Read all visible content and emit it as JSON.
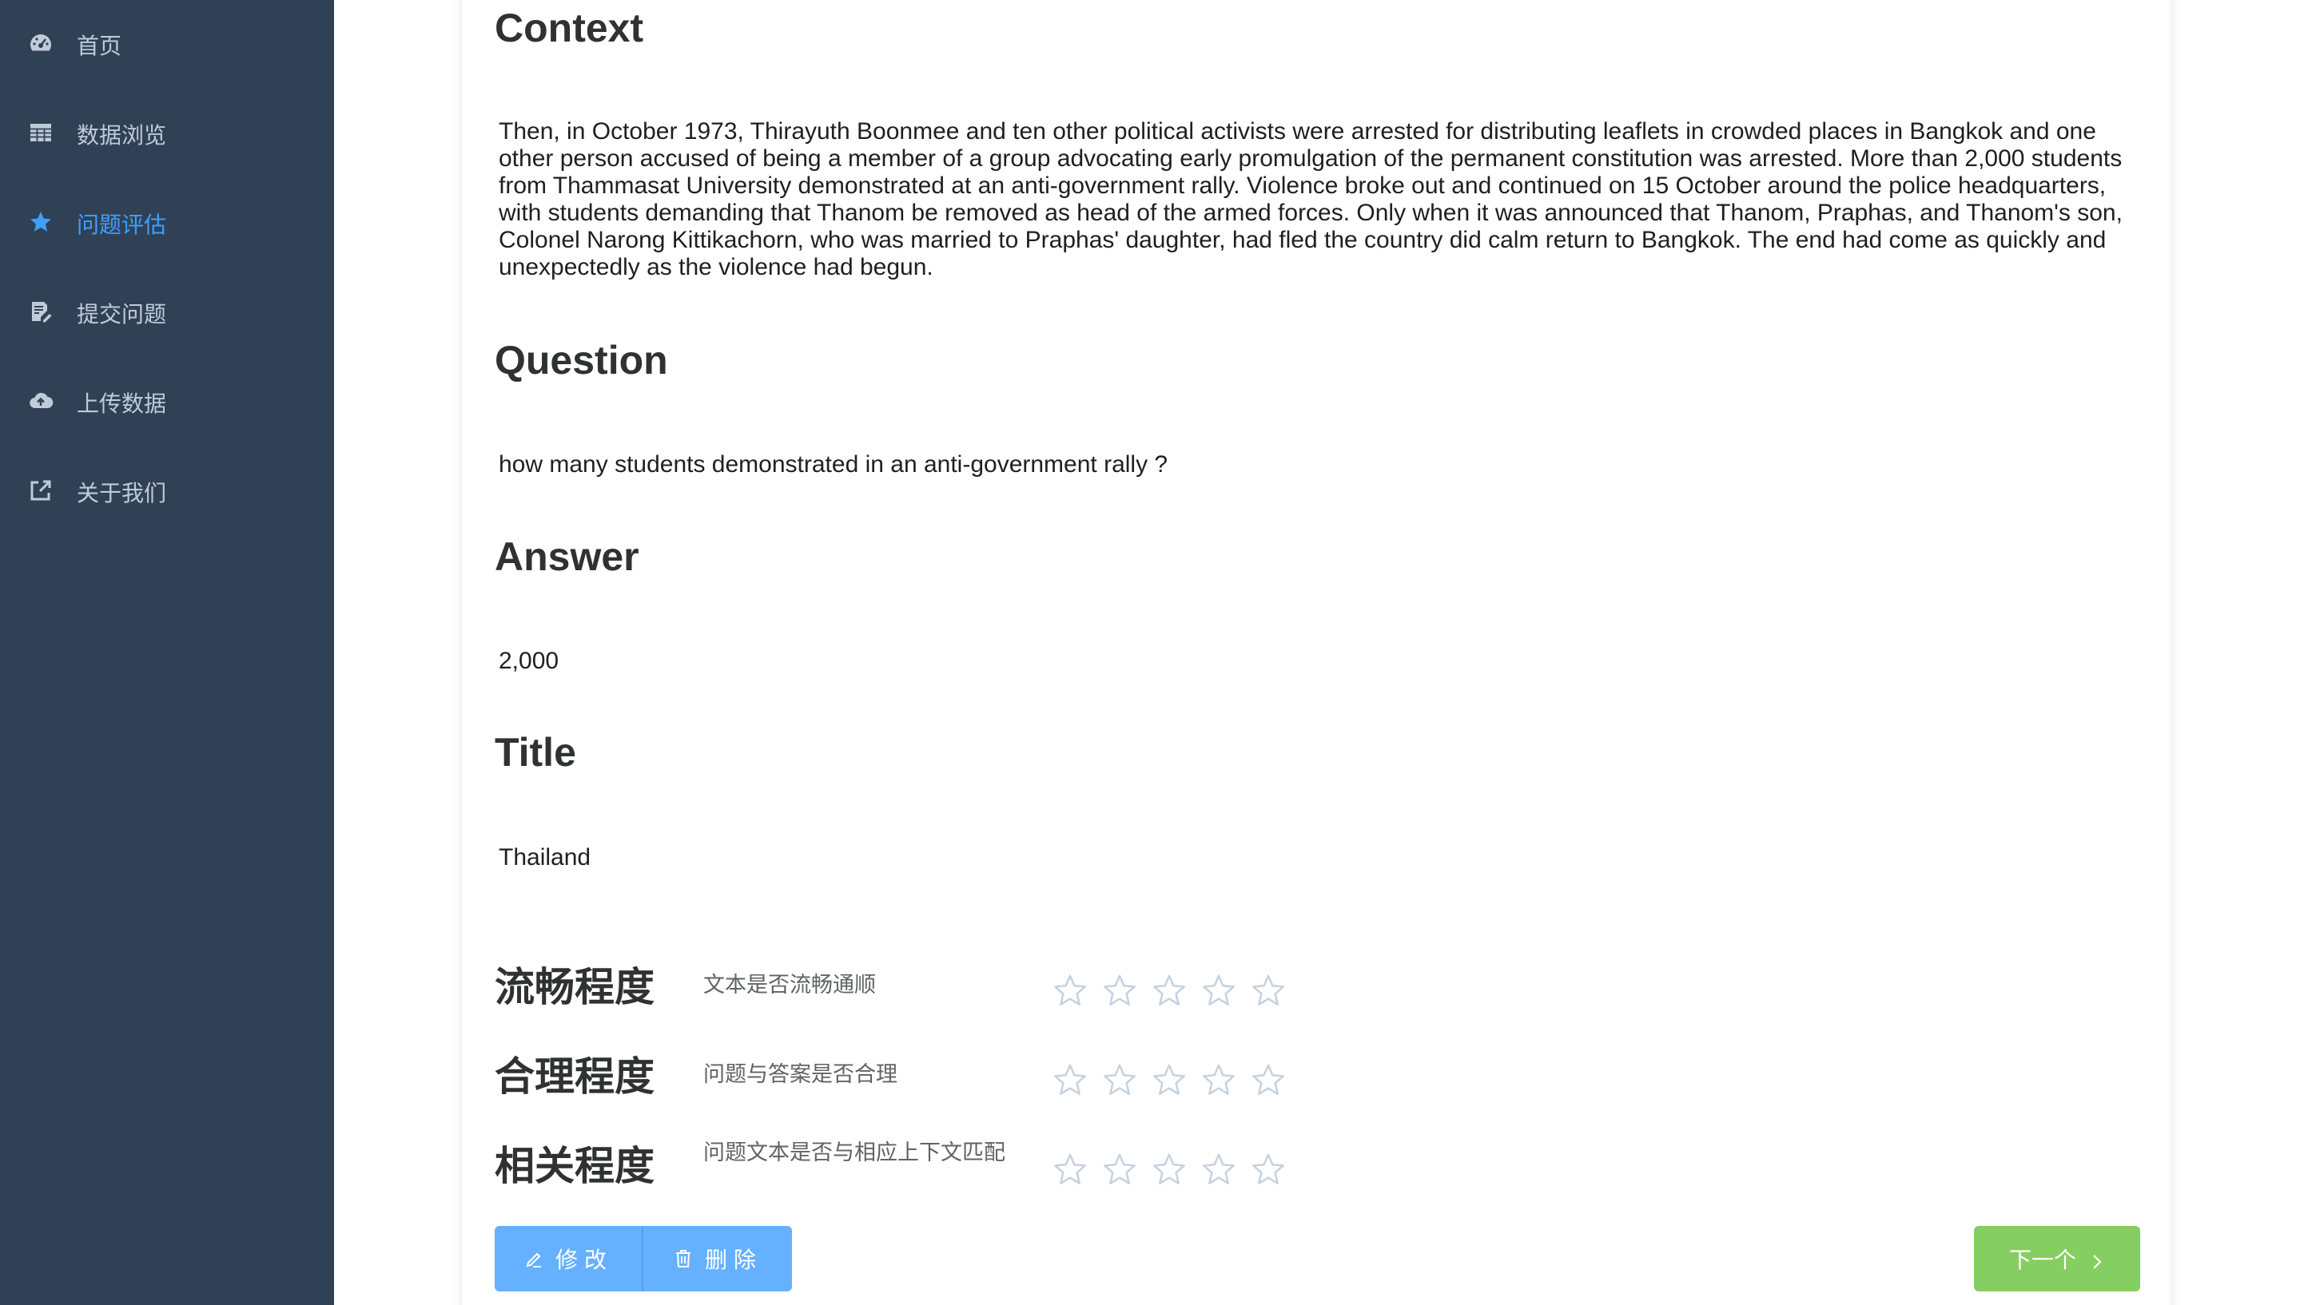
{
  "sidebar": {
    "items": [
      {
        "label": "首页",
        "icon": "dashboard-icon",
        "active": false
      },
      {
        "label": "数据浏览",
        "icon": "table-grid-icon",
        "active": false
      },
      {
        "label": "问题评估",
        "icon": "star-icon",
        "active": true
      },
      {
        "label": "提交问题",
        "icon": "edit-document-icon",
        "active": false
      },
      {
        "label": "上传数据",
        "icon": "cloud-upload-icon",
        "active": false
      },
      {
        "label": "关于我们",
        "icon": "external-link-icon",
        "active": false
      }
    ],
    "text_color": "#bfcbd9",
    "active_color": "#409eff",
    "background": "#304156"
  },
  "main": {
    "context": {
      "title": "Context",
      "body": "Then, in October 1973, Thirayuth Boonmee and ten other political activists were arrested for distributing leaflets in crowded places in Bangkok and one other person accused of being a member of a group advocating early promulgation of the permanent constitution was arrested. More than 2,000 students from Thammasat University demonstrated at an anti-government rally. Violence broke out and continued on 15 October around the police headquarters, with students demanding that Thanom be removed as head of the armed forces. Only when it was announced that Thanom, Praphas, and Thanom's son, Colonel Narong Kittikachorn, who was married to Praphas' daughter, had fled the country did calm return to Bangkok. The end had come as quickly and unexpectedly as the violence had begun."
    },
    "question": {
      "title": "Question",
      "body": "how many students demonstrated in an anti-government rally ?"
    },
    "answer": {
      "title": "Answer",
      "body": "2,000"
    },
    "doc_title": {
      "title": "Title",
      "body": "Thailand"
    },
    "ratings": [
      {
        "label": "流畅程度",
        "description": "文本是否流畅通顺",
        "max_stars": 5,
        "value": 0
      },
      {
        "label": "合理程度",
        "description": "问题与答案是否合理",
        "max_stars": 5,
        "value": 0
      },
      {
        "label": "相关程度",
        "description": "问题文本是否与相应上下文匹配",
        "max_stars": 5,
        "value": 0
      }
    ],
    "buttons": {
      "edit_label": "修改",
      "delete_label": "删除",
      "next_label": "下一个"
    },
    "colors": {
      "primary_button": "#66b1ff",
      "success_button": "#85ce61",
      "star_outline": "#c6d1de"
    }
  }
}
